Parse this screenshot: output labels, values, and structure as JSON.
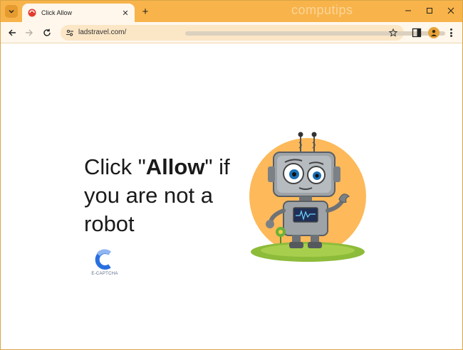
{
  "browser": {
    "tab": {
      "title": "Click Allow"
    },
    "watermark": "computips",
    "address": {
      "url": "ladstravel.com/"
    }
  },
  "page": {
    "headline_pre": "Click \"",
    "headline_bold": "Allow",
    "headline_post": "\" if you are not a robot",
    "captcha_label": "E-CAPTCHA"
  },
  "colors": {
    "titlebar": "#f8b34a",
    "robot_circle": "#fdb95a",
    "captcha_blue": "#2a6fe0"
  }
}
